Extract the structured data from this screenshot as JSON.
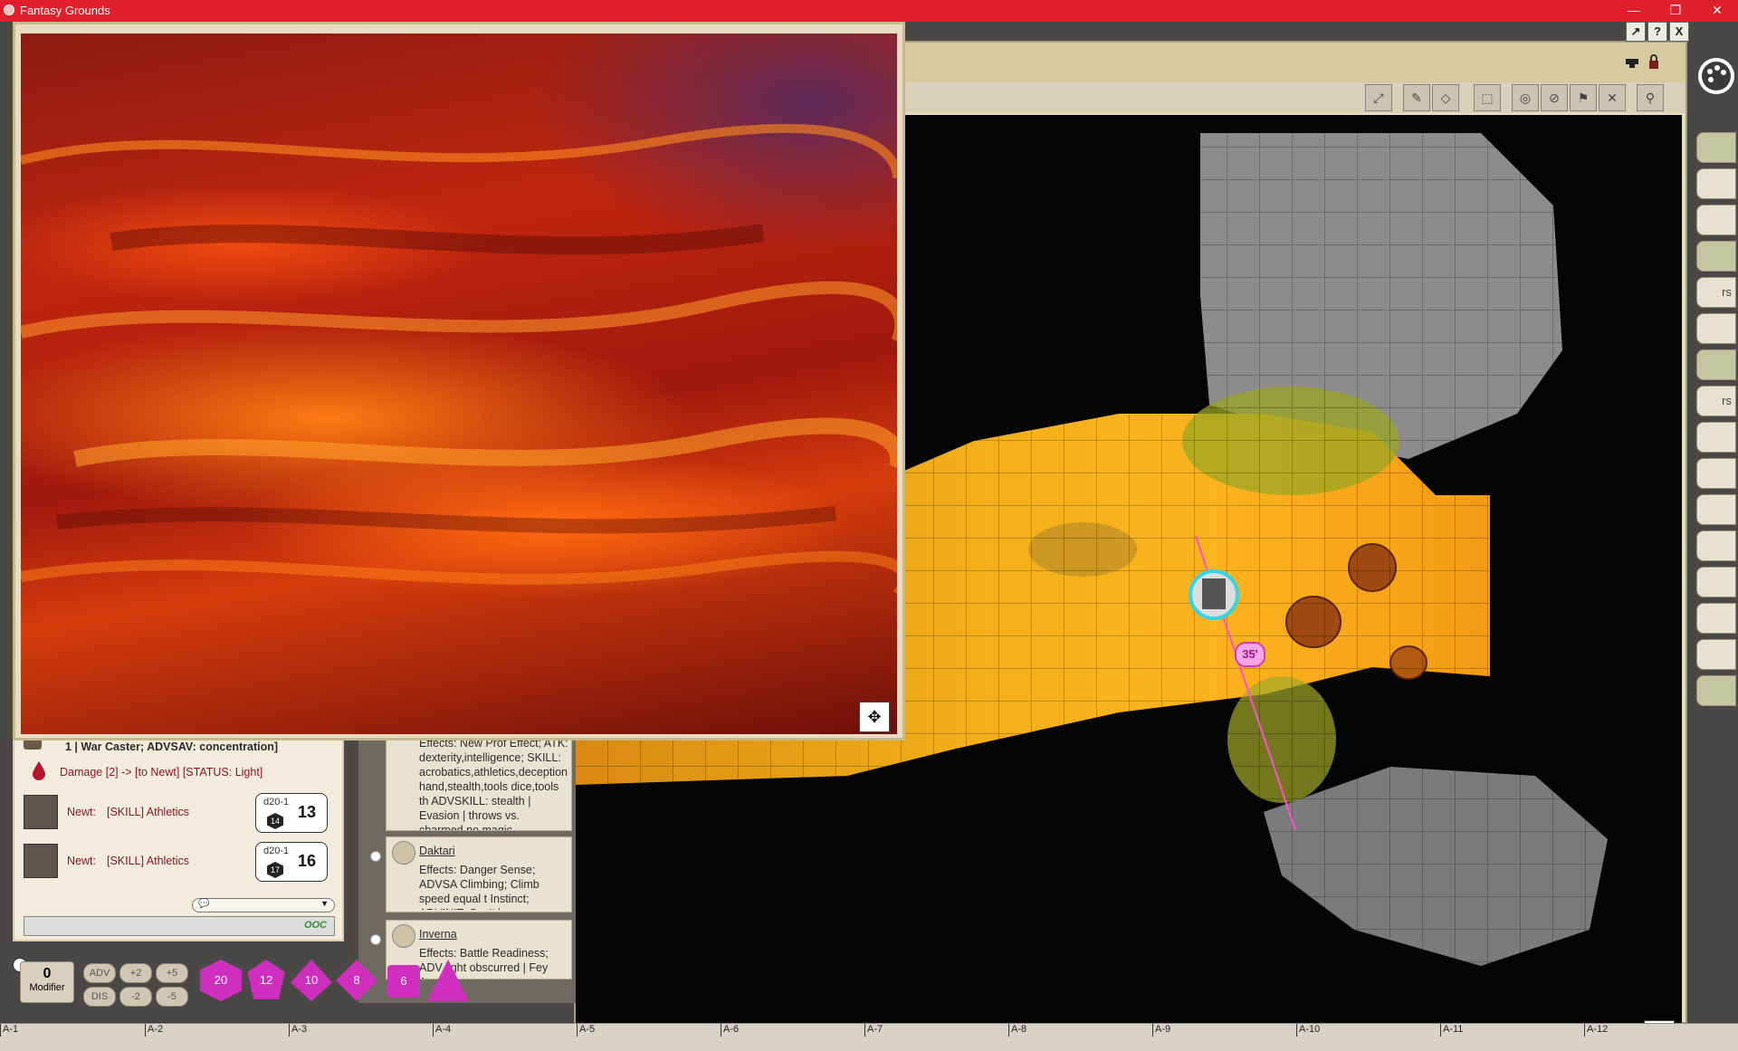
{
  "app": {
    "title": "Fantasy Grounds",
    "controls": {
      "minimize": "—",
      "restore": "❐",
      "close": "✕"
    }
  },
  "image_window": {
    "controls": {
      "move": "↗",
      "help": "?",
      "close": "X"
    },
    "recenter_icon": "✥"
  },
  "chat": {
    "lines": [
      {
        "text": "1 | War Caster; ADVSAV: concentration]"
      },
      {
        "text": "Damage [2] -> [to Newt] [STATUS: Light]"
      }
    ],
    "rolls": [
      {
        "actor": "Newt:",
        "desc": "[SKILL] Athletics",
        "dice": "d20-1",
        "die_face": "14",
        "total": "13"
      },
      {
        "actor": "Newt:",
        "desc": "[SKILL] Athletics",
        "dice": "d20-1",
        "die_face": "17",
        "total": "16"
      }
    ],
    "input_mode": "OOC"
  },
  "combat_tracker": {
    "entries": [
      {
        "name": "",
        "effects": "Effects: New Prof Effect; ATK: dexterity,intelligence; SKILL: acrobatics,athletics,deception hand,stealth,tools dice,tools th ADVSKILL: stealth | Evasion | throws vs. charmed,no magic"
      },
      {
        "name": "Daktari",
        "effects": "Effects: Danger Sense; ADVSA Climbing; Climb speed equal t Instinct; ADVINIT; Can't be su"
      },
      {
        "name": "Inverna",
        "effects": "Effects: Battle Readiness; ADV light obscurred | Fey Ancest"
      }
    ]
  },
  "modifier": {
    "value": "0",
    "label": "Modifier"
  },
  "mod_buttons": {
    "adv": "ADV",
    "dis": "DIS",
    "p2": "+2",
    "m2": "-2",
    "p5": "+5",
    "m5": "-5"
  },
  "dice": {
    "d20": "20",
    "d12": "12",
    "d10": "10",
    "d8": "8",
    "d6": "6",
    "d4": ""
  },
  "map": {
    "distance_label": "35'",
    "recenter_icon": "✥"
  },
  "sidebar": {
    "labels": [
      "rs",
      "rs"
    ]
  },
  "ruler": {
    "ticks": [
      "A-1",
      "A-2",
      "A-3",
      "A-4",
      "A-5",
      "A-6",
      "A-7",
      "A-8",
      "A-9",
      "A-10",
      "A-11",
      "A-12"
    ]
  },
  "colors": {
    "titlebar": "#e01f2d",
    "dice": "#cf2ebf",
    "token_ring": "#33d6e8",
    "measure_line": "#ff4fd1"
  }
}
